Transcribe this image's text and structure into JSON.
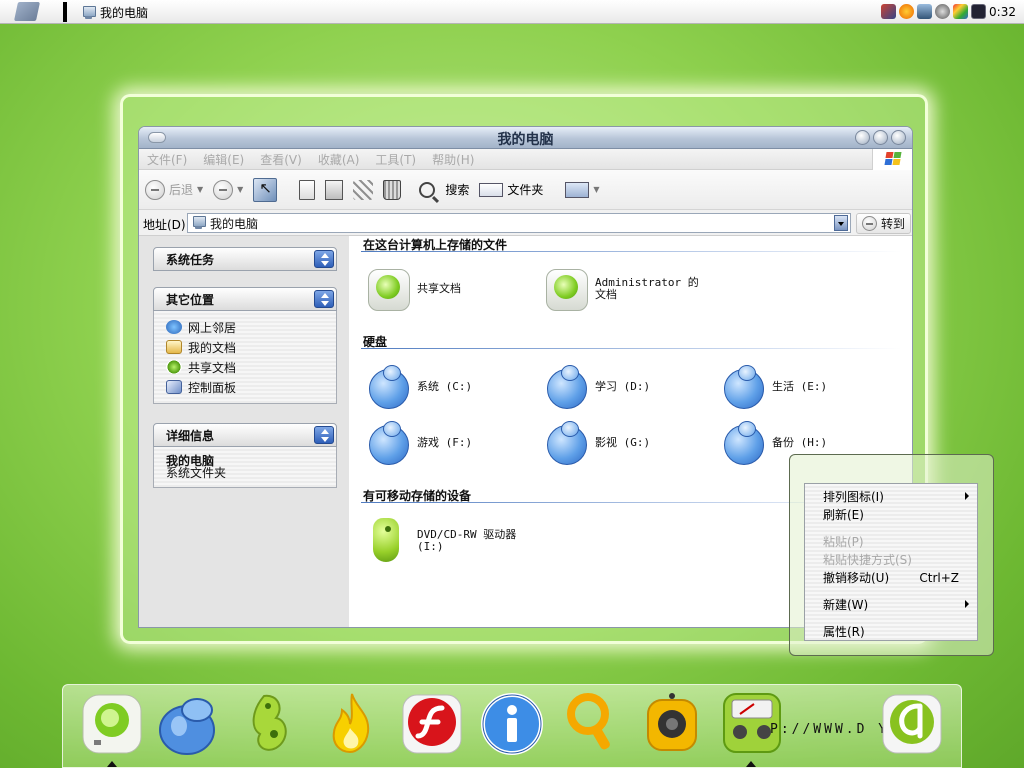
{
  "taskbar": {
    "active_window": "我的电脑",
    "clock": "0:32"
  },
  "window": {
    "title": "我的电脑",
    "menu": [
      "文件(F)",
      "编辑(E)",
      "查看(V)",
      "收藏(A)",
      "工具(T)",
      "帮助(H)"
    ],
    "toolbar": {
      "back": "后退",
      "search": "搜索",
      "folders": "文件夹"
    },
    "address": {
      "label": "地址(D)",
      "value": "我的电脑",
      "go": "转到"
    }
  },
  "taskpane": {
    "system_tasks": "系统任务",
    "other_places": {
      "title": "其它位置",
      "items": [
        "网上邻居",
        "我的文档",
        "共享文档",
        "控制面板"
      ]
    },
    "details": {
      "title": "详细信息",
      "name": "我的电脑",
      "type": "系统文件夹"
    }
  },
  "content": {
    "stored_files": {
      "title": "在这台计算机上存储的文件",
      "items": [
        "共享文档",
        "Administrator 的文档"
      ]
    },
    "hard_disks": {
      "title": "硬盘",
      "items": [
        "系统 (C:)",
        "学习 (D:)",
        "生活 (E:)",
        "游戏 (F:)",
        "影视 (G:)",
        "备份 (H:)"
      ]
    },
    "removable": {
      "title": "有可移动存储的设备",
      "items": [
        "DVD/CD-RW 驱动器 (I:)"
      ]
    }
  },
  "context_menu": {
    "arrange": "排列图标(I)",
    "refresh": "刷新(E)",
    "paste": "粘贴(P)",
    "paste_shortcut": "粘贴快捷方式(S)",
    "undo_move": "撤销移动(U)",
    "undo_shortcut": "Ctrl+Z",
    "new": "新建(W)",
    "properties": "属性(R)"
  },
  "dock": {
    "url_text": "P://WWW.D        Y.NET"
  },
  "colors": {
    "desktop_green": "#8fd14f",
    "hdd_blue": "#5fa0e8",
    "accent_blue": "#2f5fb8"
  }
}
